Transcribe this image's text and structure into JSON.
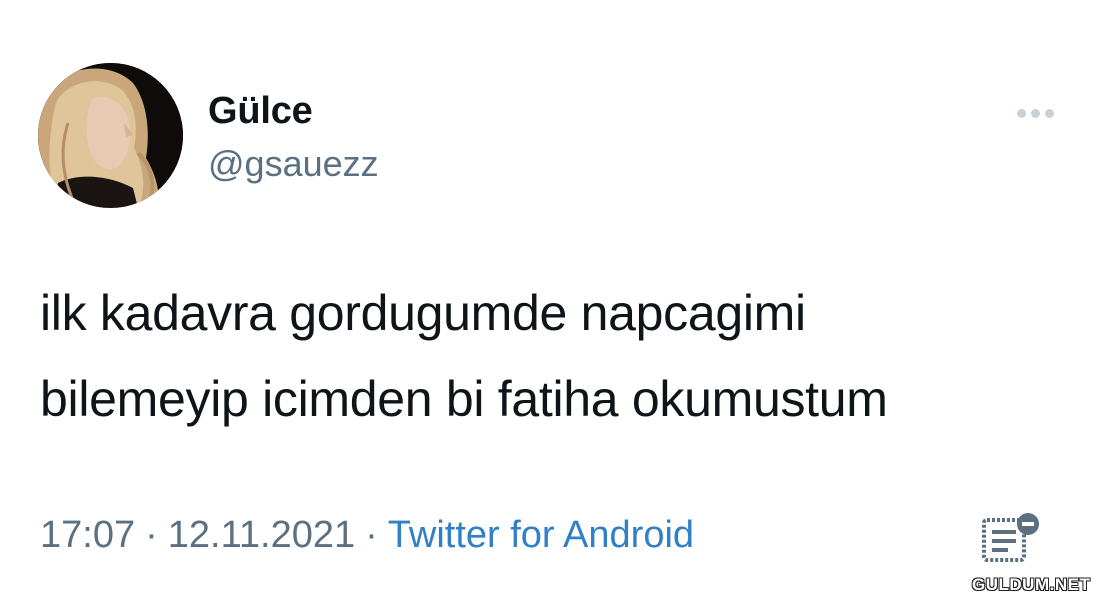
{
  "author": {
    "display_name": "Gülce",
    "handle": "@gsauezz",
    "avatar_icon": "profile-photo"
  },
  "tweet": {
    "text_lines": [
      "ilk kadavra gordugumde napcagimi",
      "bilemeyip icimden bi fatiha okumustum"
    ]
  },
  "meta": {
    "time": "17:07",
    "separator": "·",
    "date": "12.11.2021",
    "source": "Twitter for Android"
  },
  "actions": {
    "more_icon": "more-horizontal-icon",
    "analytics_icon": "analytics-icon"
  },
  "watermark": {
    "text": "GULDUM.NET"
  },
  "colors": {
    "text_primary": "#0f1419",
    "text_secondary": "#5b7083",
    "link": "#2f80c7",
    "background": "#ffffff"
  }
}
